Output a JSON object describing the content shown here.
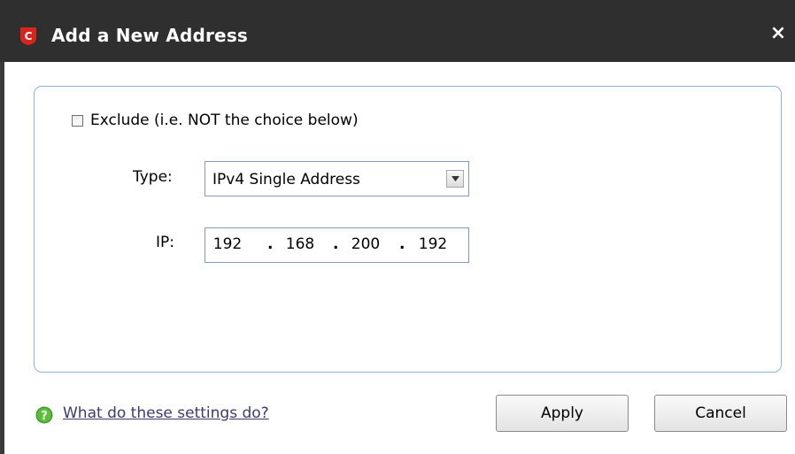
{
  "window": {
    "title": "Add a New Address",
    "close_glyph": "×",
    "logo_letter": "C",
    "logo_color": "#d9261c",
    "titlebar_color": "#2f2f2f"
  },
  "form": {
    "exclude": {
      "label": "Exclude (i.e. NOT the choice below)",
      "checked": false
    },
    "type": {
      "label": "Type:",
      "value": "IPv4 Single Address",
      "arrow_icon": "chevron-down-icon"
    },
    "ip": {
      "label": "IP:",
      "octets": [
        "192",
        "168",
        "200",
        "192"
      ]
    }
  },
  "footer": {
    "help_link": "What do these settings do?",
    "help_icon": "help-icon",
    "apply_label": "Apply",
    "cancel_label": "Cancel"
  }
}
